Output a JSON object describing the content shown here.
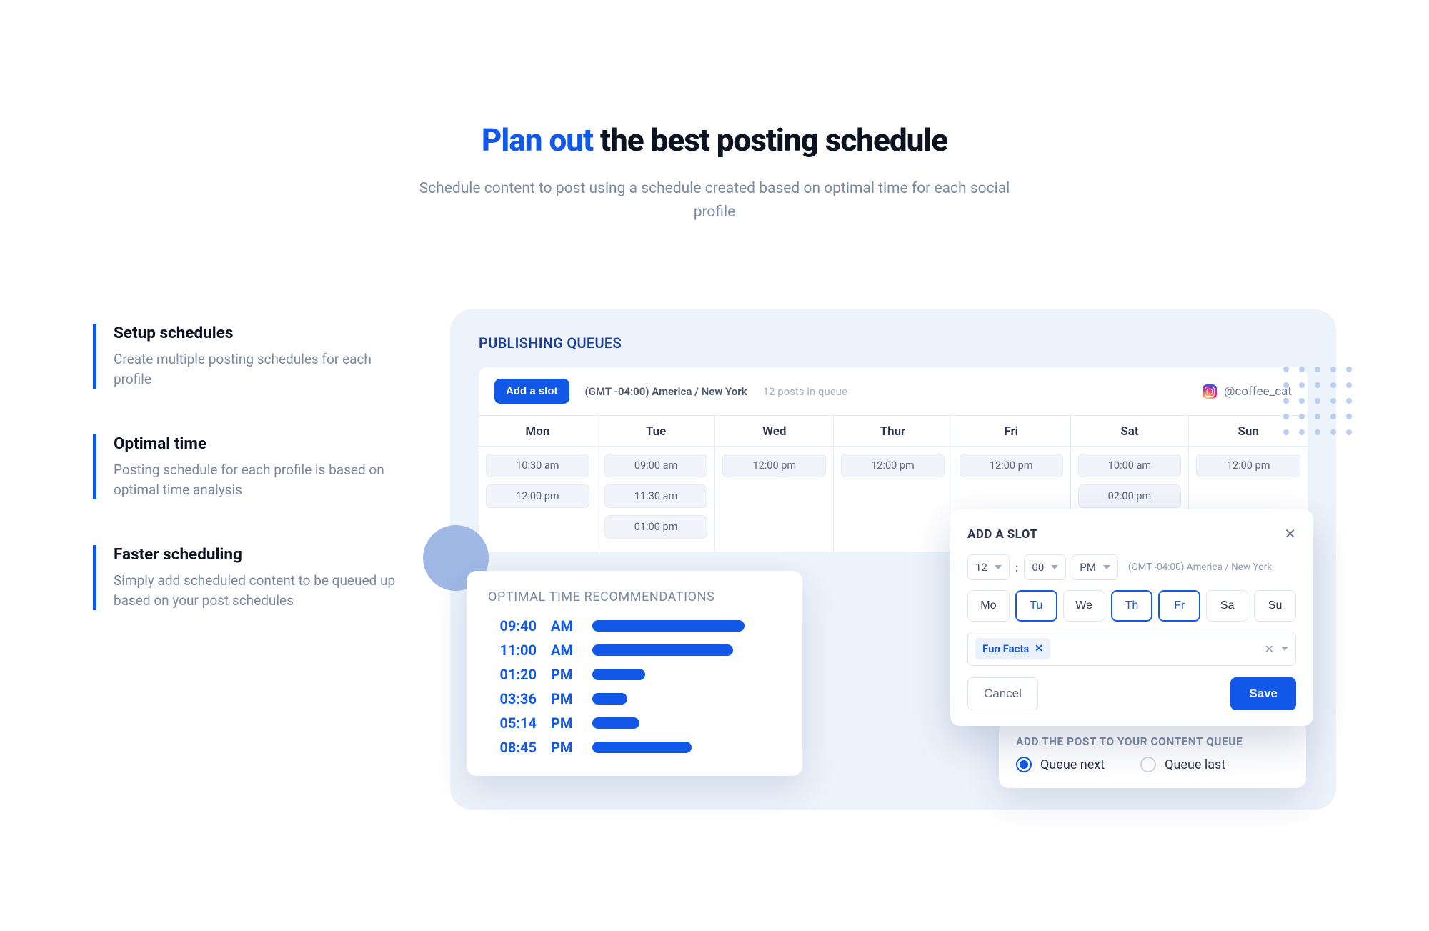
{
  "hero": {
    "accent": "Plan out",
    "rest": " the best posting schedule",
    "subtitle": "Schedule content to post using a schedule created based on optimal time for each social profile"
  },
  "features": [
    {
      "title": "Setup schedules",
      "desc": "Create multiple posting schedules for each profile"
    },
    {
      "title": "Optimal time",
      "desc": "Posting schedule for each profile is based on optimal time analysis"
    },
    {
      "title": "Faster scheduling",
      "desc": "Simply add scheduled content to be queued up based on your post schedules"
    }
  ],
  "panel": {
    "title": "PUBLISHING QUEUES",
    "add_slot_label": "Add a slot",
    "timezone": "(GMT -04:00) America / New York",
    "queue_count": "12 posts in queue",
    "handle": "@coffee_cat"
  },
  "days": [
    {
      "name": "Mon",
      "slots": [
        "10:30 am",
        "12:00 pm"
      ]
    },
    {
      "name": "Tue",
      "slots": [
        "09:00 am",
        "11:30 am",
        "01:00 pm"
      ]
    },
    {
      "name": "Wed",
      "slots": [
        "12:00 pm"
      ]
    },
    {
      "name": "Thur",
      "slots": [
        "12:00 pm"
      ]
    },
    {
      "name": "Fri",
      "slots": [
        "12:00 pm"
      ]
    },
    {
      "name": "Sat",
      "slots": [
        "10:00 am",
        "02:00 pm"
      ]
    },
    {
      "name": "Sun",
      "slots": [
        "12:00 pm"
      ]
    }
  ],
  "optimal": {
    "title": "OPTIMAL TIME RECOMMENDATIONS",
    "rows": [
      {
        "time": "09:40",
        "ampm": "AM",
        "pct": 52
      },
      {
        "time": "11:00",
        "ampm": "AM",
        "pct": 48
      },
      {
        "time": "01:20",
        "ampm": "PM",
        "pct": 18
      },
      {
        "time": "03:36",
        "ampm": "PM",
        "pct": 12
      },
      {
        "time": "05:14",
        "ampm": "PM",
        "pct": 16
      },
      {
        "time": "08:45",
        "ampm": "PM",
        "pct": 34
      }
    ]
  },
  "addslot": {
    "title": "ADD A SLOT",
    "hour": "12",
    "minute": "00",
    "ampm": "PM",
    "timezone": "(GMT -04:00) America / New York",
    "days": [
      {
        "abbr": "Mo",
        "on": false
      },
      {
        "abbr": "Tu",
        "on": true
      },
      {
        "abbr": "We",
        "on": false
      },
      {
        "abbr": "Th",
        "on": true
      },
      {
        "abbr": "Fr",
        "on": true
      },
      {
        "abbr": "Sa",
        "on": false
      },
      {
        "abbr": "Su",
        "on": false
      }
    ],
    "tag": "Fun Facts",
    "cancel_label": "Cancel",
    "save_label": "Save"
  },
  "queue_radio": {
    "title": "ADD THE POST TO YOUR CONTENT QUEUE",
    "next_label": "Queue next",
    "last_label": "Queue last",
    "selected": "next"
  }
}
